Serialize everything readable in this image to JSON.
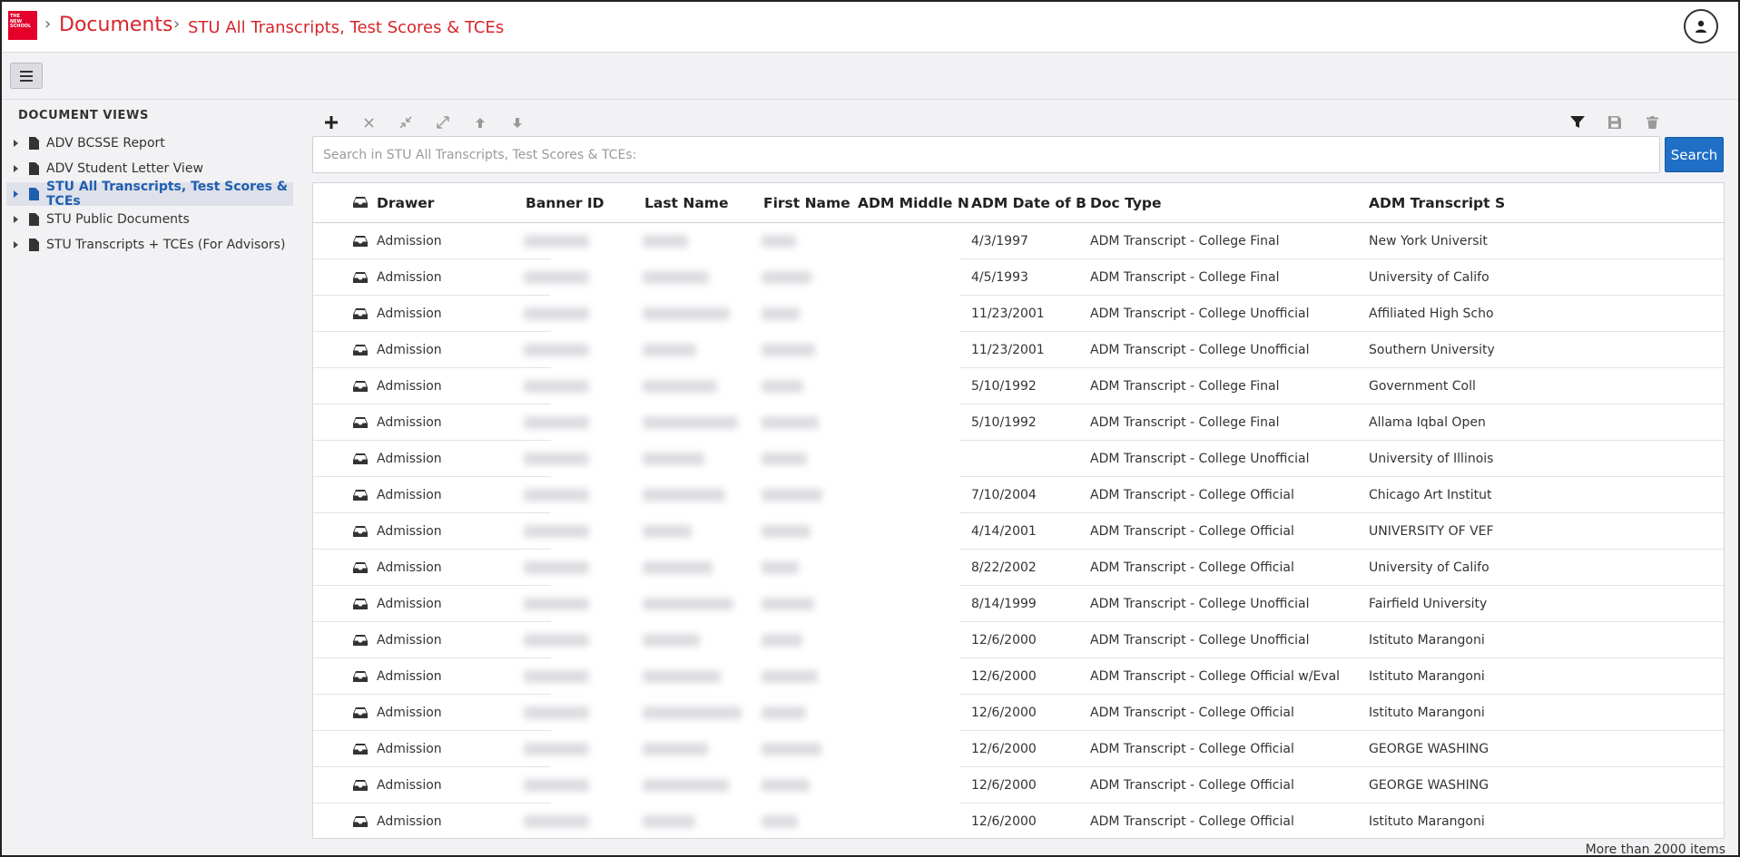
{
  "header": {
    "logo_lines": [
      "THE",
      "NEW",
      "SCHOOL"
    ],
    "breadcrumb_root": "Documents",
    "breadcrumb_current": "STU All Transcripts, Test Scores & TCEs"
  },
  "sidebar": {
    "title": "DOCUMENT VIEWS",
    "items": [
      {
        "label": "ADV BCSSE Report"
      },
      {
        "label": "ADV Student Letter View"
      },
      {
        "label": "STU All Transcripts, Test Scores & TCEs"
      },
      {
        "label": "STU Public Documents"
      },
      {
        "label": "STU Transcripts + TCEs (For Advisors)"
      }
    ]
  },
  "search": {
    "placeholder": "Search in STU All Transcripts, Test Scores & TCEs:",
    "button_label": "Search"
  },
  "grid": {
    "columns": [
      "Drawer",
      "Banner ID",
      "Last Name",
      "First Name",
      "ADM Middle N...",
      "ADM Date of Bir...",
      "Doc Type",
      "ADM Transcript S"
    ],
    "rows": [
      {
        "drawer": "Admission",
        "dob": "4/3/1997",
        "doc_type": "ADM Transcript - College Final",
        "school": "New York Universit"
      },
      {
        "drawer": "Admission",
        "dob": "4/5/1993",
        "doc_type": "ADM Transcript - College Final",
        "school": "University of Califo"
      },
      {
        "drawer": "Admission",
        "dob": "11/23/2001",
        "doc_type": "ADM Transcript - College Unofficial",
        "school": "Affiliated High Scho"
      },
      {
        "drawer": "Admission",
        "dob": "11/23/2001",
        "doc_type": "ADM Transcript - College Unofficial",
        "school": "Southern University"
      },
      {
        "drawer": "Admission",
        "dob": "5/10/1992",
        "doc_type": "ADM Transcript - College Final",
        "school": "Government Coll"
      },
      {
        "drawer": "Admission",
        "dob": "5/10/1992",
        "doc_type": "ADM Transcript - College Final",
        "school": "Allama Iqbal Open"
      },
      {
        "drawer": "Admission",
        "dob": "",
        "doc_type": "ADM Transcript - College Unofficial",
        "school": "University of Illinois"
      },
      {
        "drawer": "Admission",
        "dob": "7/10/2004",
        "doc_type": "ADM Transcript - College Official",
        "school": "Chicago Art Institut"
      },
      {
        "drawer": "Admission",
        "dob": "4/14/2001",
        "doc_type": "ADM Transcript - College Official",
        "school": "UNIVERSITY OF VEF"
      },
      {
        "drawer": "Admission",
        "dob": "8/22/2002",
        "doc_type": "ADM Transcript - College Official",
        "school": "University of Califo"
      },
      {
        "drawer": "Admission",
        "dob": "8/14/1999",
        "doc_type": "ADM Transcript - College Unofficial",
        "school": "Fairfield University"
      },
      {
        "drawer": "Admission",
        "dob": "12/6/2000",
        "doc_type": "ADM Transcript - College Unofficial",
        "school": "Istituto Marangoni"
      },
      {
        "drawer": "Admission",
        "dob": "12/6/2000",
        "doc_type": "ADM Transcript - College Official w/Eval",
        "school": "Istituto Marangoni"
      },
      {
        "drawer": "Admission",
        "dob": "12/6/2000",
        "doc_type": "ADM Transcript - College Official",
        "school": "Istituto Marangoni"
      },
      {
        "drawer": "Admission",
        "dob": "12/6/2000",
        "doc_type": "ADM Transcript - College Official",
        "school": "GEORGE WASHING"
      },
      {
        "drawer": "Admission",
        "dob": "12/6/2000",
        "doc_type": "ADM Transcript - College Official",
        "school": "GEORGE WASHING"
      },
      {
        "drawer": "Admission",
        "dob": "12/6/2000",
        "doc_type": "ADM Transcript - College Official",
        "school": "Istituto Marangoni"
      }
    ],
    "item_count": "More than 2000 items"
  },
  "colors": {
    "brand_red": "#d6252a",
    "accent_blue": "#1f6fc6",
    "active_text": "#1f5fb0"
  }
}
